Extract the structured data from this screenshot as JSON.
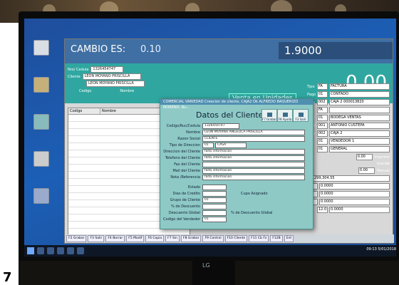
{
  "header": {
    "cambio_label": "CAMBIO ES:",
    "cambio_value": "0.10",
    "rate": "1.9000",
    "total": "0.00",
    "venta_mode": "Venta en Unidades"
  },
  "client": {
    "nro_label": "Nro/ Cedula",
    "nro_value": "1326454747",
    "cliente_label": "Cliente",
    "cliente_value": "LEON MOYANO PRISCILLA",
    "cliente_value2": "LEON MOYANO PRISCILLA",
    "codigo_label": "Codigo",
    "nombre_label": "Nombre"
  },
  "grid": {
    "col_codigo": "Codigo",
    "col_nombre": "Nombre"
  },
  "right_panel": {
    "rows": [
      {
        "label": "Tipo",
        "code": "FA",
        "value": "FACTURA"
      },
      {
        "label": "Pago",
        "code": "01",
        "value": "CONTADO"
      },
      {
        "label": "Caja",
        "code": "002",
        "value": "CAJA 2   000013820"
      },
      {
        "label": "Fac",
        "code": "FA",
        "value": ""
      },
      {
        "label": "Bod",
        "code": "01",
        "value": "BODEGA VENTAS"
      },
      {
        "label": "Vend",
        "code": "001",
        "value": "ANTONIO CUSTEPA"
      },
      {
        "label": "Caja",
        "code": "002",
        "value": "CAJA 2"
      },
      {
        "label": "Vdr",
        "code": "01",
        "value": "VENDEDOR 1"
      },
      {
        "label": "Lis",
        "code": "01",
        "value": "GENERAL"
      }
    ],
    "opt_imprimir": "Imprimir",
    "opt_grande": "Grande",
    "opt_manual": "Manual",
    "amount_1": "0.00",
    "amount_2": "0.00",
    "amount_3": "$9,299,304.55",
    "pct_12": "12",
    "iva_label": "IVA",
    "iva_value": "12.0",
    "totals": [
      "0.0000",
      "0.0000",
      "0.0000",
      "0.0000"
    ]
  },
  "dialog": {
    "titlebar": "COMERCIAL VARIEDAD Creacion de cliente, CAJA2 Ok ALFREDO BAQUERIZO MORENO, Ru...",
    "title": "Datos del Cliente",
    "btn_grabar": "F7 Grabar",
    "btn_ayuda": "F8 Ayuda",
    "btn_salir": "F3 Salir",
    "fields": {
      "codigo_label": "Codigo/Ruc/Cedula",
      "codigo_value": "1326454747",
      "nombre_label": "Nombre",
      "nombre_value": "LEON MOYANO ANGELICA PRISCILLA",
      "razon_label": "Razon Social",
      "razon_value": "CLIENTE",
      "tipo_dir_label": "Tipo de Direccion",
      "tipo_dir_code": "01",
      "tipo_dir_value": "CASA",
      "direccion_label": "Direccion del Cliente",
      "direccion_value": "falta informacion",
      "telefono_label": "Telefono del Cliente",
      "telefono_value": "falta informacion",
      "fax_label": "Fax del Cliente",
      "fax_value": "",
      "mail_label": "Mail del Cliente",
      "mail_value": "falta informacion",
      "ref_label": "Nota /Referencia",
      "ref_value": "falta informacion",
      "estado_label": "Estado",
      "dias_label": "Dias de Credito",
      "grupo_label": "Grupo de Cliente",
      "grupo_value": "01",
      "pct_label": "% de Descuento",
      "desc_global_label": "Descuento Global",
      "pct_global_label": "% de Descuento Global",
      "vendedor_label": "Codigo del Vendedor",
      "vendedor_value": "01",
      "cupo_label": "Cupo Asignado"
    }
  },
  "status_bar": [
    "F2 Grabar",
    "F3 Salir",
    "F4 Borrar",
    "F5 Modif",
    "F6 Copia",
    "F7 Sin",
    "F8 Grabar",
    "F9 Control",
    "F10 Cliente",
    "F11 Cb Fz",
    "F12B",
    "Ent",
    "Alt Q",
    "F2 Ing. Navegador",
    "Alt G",
    "Entrega",
    "Despacho"
  ],
  "taskbar": {
    "clock": "09:13 ",
    "date": "5/01/2018"
  },
  "monitor_brand": "LG",
  "frame_digit": "7"
}
